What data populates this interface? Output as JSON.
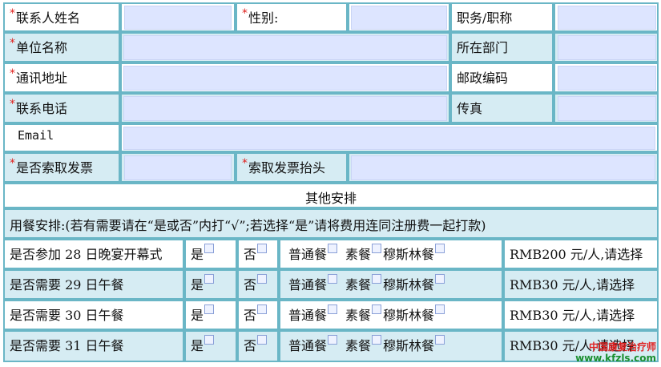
{
  "required_mark": "*",
  "rows": {
    "contact_name": "联系人姓名",
    "gender": "性别:",
    "position": "职务/职称",
    "company": "单位名称",
    "department": "所在部门",
    "address": "通讯地址",
    "postcode": "邮政编码",
    "phone": "联系电话",
    "fax": "传真",
    "email": "Email",
    "invoice": "是否索取发票",
    "invoice_title": "索取发票抬头"
  },
  "other": {
    "title": "其他安排",
    "note": "用餐安排:(若有需要请在“是或否”内打“√”;若选择“是”请将费用连同注册费一起打款)"
  },
  "meal_options": {
    "yes": "是",
    "no": "否",
    "regular": "普通餐",
    "vegetarian": "素餐",
    "muslim": "穆斯林餐"
  },
  "meals": [
    {
      "label": "是否参加 28 日晚宴开幕式",
      "price": "RMB200 元/人,请选择"
    },
    {
      "label": "是否需要 29 日午餐",
      "price": "RMB30 元/人,请选择"
    },
    {
      "label": "是否需要 30 日午餐",
      "price": "RMB30 元/人,请选择"
    },
    {
      "label": "是否需要 31 日午餐",
      "price": "RMB30 元/人,请选择"
    }
  ],
  "watermark": {
    "line1": "中国康复治疗师",
    "line2": "www.kfzls.com"
  },
  "colors": {
    "border": "#6ab6c6",
    "row_fill": "#d6ecf3",
    "input_fill": "#dde5ff",
    "required": "#e0201c"
  }
}
